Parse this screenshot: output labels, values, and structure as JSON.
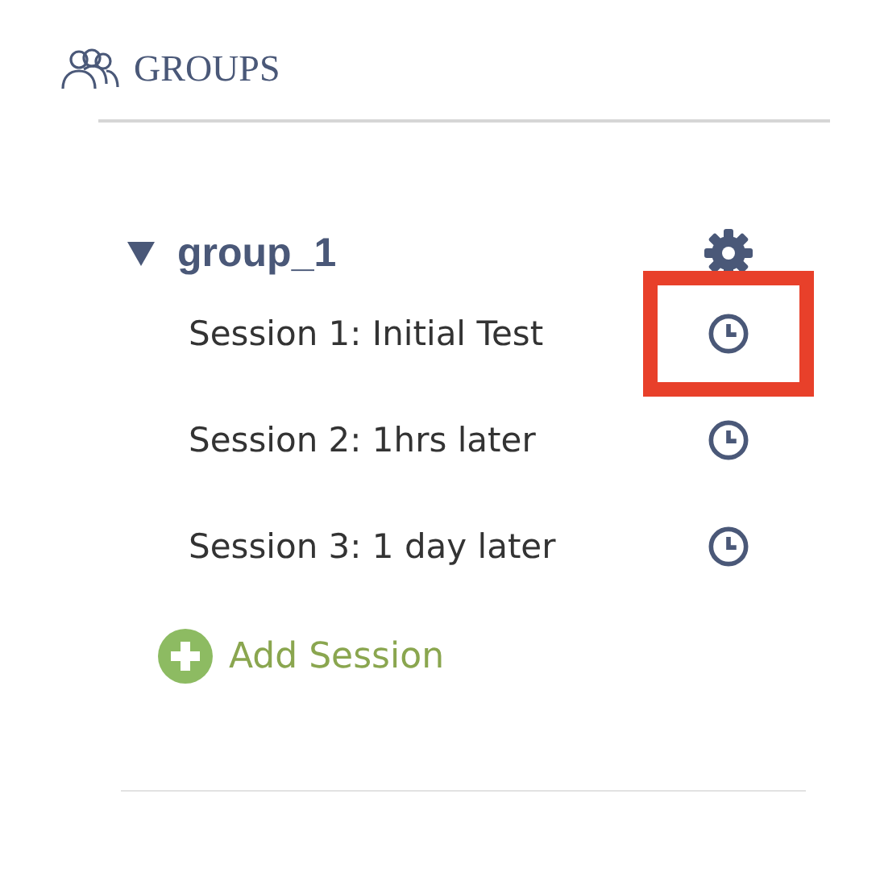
{
  "header": {
    "title": "GROUPS"
  },
  "groups": [
    {
      "name": "group_1",
      "expanded": true,
      "sessions": [
        {
          "label": "Session 1: Initial Test",
          "highlighted": true
        },
        {
          "label": "Session 2: 1hrs later",
          "highlighted": false
        },
        {
          "label": "Session 3: 1 day later",
          "highlighted": false
        }
      ],
      "add_label": "Add Session"
    }
  ]
}
